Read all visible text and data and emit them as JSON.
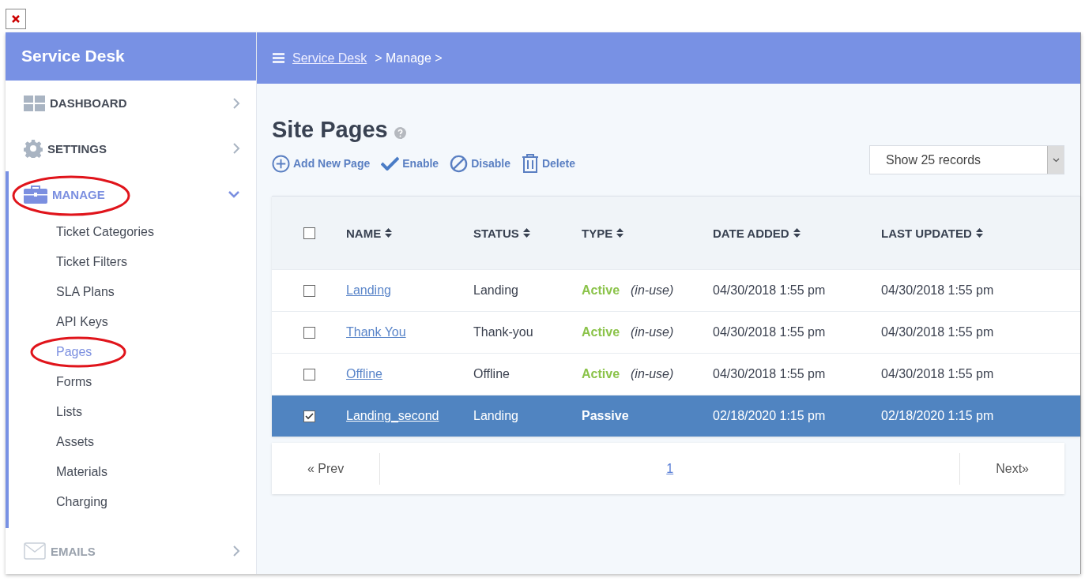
{
  "sidebar": {
    "title": "Service Desk",
    "sections": [
      {
        "label": "DASHBOARD",
        "expanded": false,
        "selected": false,
        "disabled": false,
        "circled": false
      },
      {
        "label": "SETTINGS",
        "expanded": false,
        "selected": false,
        "disabled": false,
        "circled": false
      },
      {
        "label": "MANAGE",
        "expanded": true,
        "selected": true,
        "disabled": false,
        "circled": true,
        "children": [
          {
            "label": "Ticket Categories",
            "selected": false,
            "circled": false
          },
          {
            "label": "Ticket Filters",
            "selected": false,
            "circled": false
          },
          {
            "label": "SLA Plans",
            "selected": false,
            "circled": false
          },
          {
            "label": "API Keys",
            "selected": false,
            "circled": false
          },
          {
            "label": "Pages",
            "selected": true,
            "circled": true
          },
          {
            "label": "Forms",
            "selected": false,
            "circled": false
          },
          {
            "label": "Lists",
            "selected": false,
            "circled": false
          },
          {
            "label": "Assets",
            "selected": false,
            "circled": false
          },
          {
            "label": "Materials",
            "selected": false,
            "circled": false
          },
          {
            "label": "Charging",
            "selected": false,
            "circled": false
          }
        ]
      },
      {
        "label": "EMAILS",
        "expanded": false,
        "selected": false,
        "disabled": true,
        "circled": false
      }
    ]
  },
  "breadcrumb": {
    "link": "Service Desk",
    "items": [
      "> Manage >"
    ]
  },
  "page": {
    "title": "Site Pages"
  },
  "toolbar": [
    {
      "label": "Add New Page"
    },
    {
      "label": "Enable"
    },
    {
      "label": "Disable"
    },
    {
      "label": "Delete"
    }
  ],
  "records_select": {
    "value": "Show 25 records"
  },
  "table": {
    "columns": [
      "NAME",
      "STATUS",
      "TYPE",
      "DATE ADDED",
      "LAST UPDATED"
    ],
    "all_checked": false,
    "rows": [
      {
        "name": "Landing",
        "status": "Landing",
        "type": "Active",
        "note": "(in-use)",
        "date_added": "04/30/2018 1:55 pm",
        "last_updated": "04/30/2018 1:55 pm",
        "checked": false,
        "selected": false
      },
      {
        "name": "Thank You",
        "status": "Thank-you",
        "type": "Active",
        "note": "(in-use)",
        "date_added": "04/30/2018 1:55 pm",
        "last_updated": "04/30/2018 1:55 pm",
        "checked": false,
        "selected": false
      },
      {
        "name": "Offline",
        "status": "Offline",
        "type": "Active",
        "note": "(in-use)",
        "date_added": "04/30/2018 1:55 pm",
        "last_updated": "04/30/2018 1:55 pm",
        "checked": false,
        "selected": false
      },
      {
        "name": "Landing_second",
        "status": "Landing",
        "type": "Passive",
        "date_added": "02/18/2020 1:15 pm",
        "last_updated": "02/18/2020 1:15 pm",
        "checked": true,
        "selected": true
      }
    ]
  },
  "pagination": {
    "prev": "« Prev",
    "pages": [
      {
        "label": "1",
        "selected": true
      }
    ],
    "next": "Next»"
  }
}
